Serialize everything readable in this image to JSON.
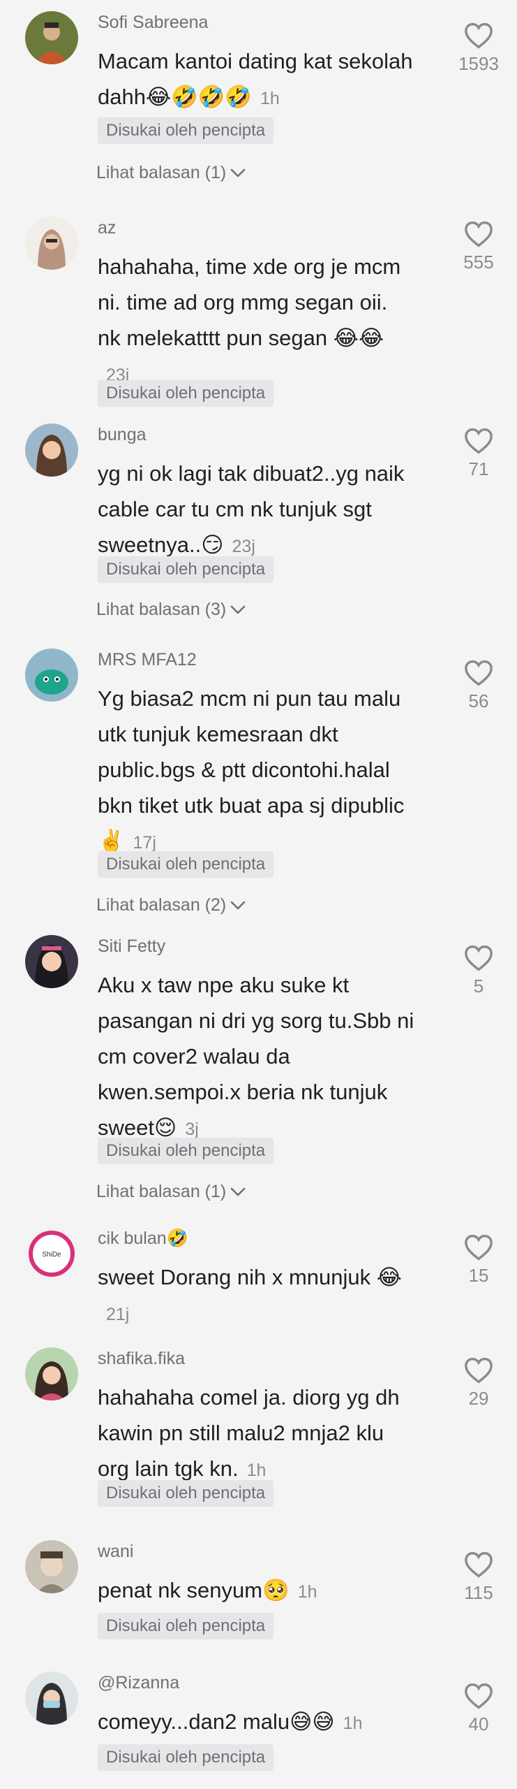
{
  "colors": {
    "background": "#f4f4f4",
    "text": "#1f1f24",
    "muted": "#8a8b91",
    "tag_bg": "#e6e6e8"
  },
  "liked_label": "Disukai oleh pencipta",
  "comments": [
    {
      "user": "Sofi Sabreena",
      "text": "Macam kantoi dating kat sekolah dahh😂🤣🤣🤣",
      "time": "1h",
      "likes": "1593",
      "liked_by_creator": true,
      "replies": "Lihat balasan (1)"
    },
    {
      "user": "az",
      "text": "hahahaha, time xde org je mcm ni. time ad org mmg segan oii. nk melekatttt pun segan 😂😂",
      "time": "23j",
      "likes": "555",
      "liked_by_creator": true,
      "replies": ""
    },
    {
      "user": "bunga",
      "text": "yg ni ok lagi tak dibuat2..yg naik cable car tu cm nk tunjuk sgt sweetnya..😏",
      "time": "23j",
      "likes": "71",
      "liked_by_creator": true,
      "replies": "Lihat balasan (3)"
    },
    {
      "user": "MRS MFA12",
      "text": "Yg biasa2 mcm ni pun tau malu utk tunjuk kemesraan dkt public.bgs & ptt dicontohi.halal bkn tiket utk buat apa sj dipublic ✌️",
      "time": "17j",
      "likes": "56",
      "liked_by_creator": true,
      "replies": "Lihat balasan (2)"
    },
    {
      "user": "Siti Fetty",
      "text": "Aku x taw npe aku suke kt pasangan ni dri yg sorg tu.Sbb ni cm cover2 walau da kwen.sempoi.x beria nk tunjuk sweet😌",
      "time": "3j",
      "likes": "5",
      "liked_by_creator": true,
      "replies": "Lihat balasan (1)"
    },
    {
      "user": "cik bulan🤣",
      "text": "sweet Dorang nih x mnunjuk 😂",
      "time": "21j",
      "likes": "15",
      "liked_by_creator": false,
      "replies": ""
    },
    {
      "user": "shafika.fika",
      "text": "hahahaha comel ja. diorg yg dh kawin pn still malu2 mnja2 klu org lain tgk kn.",
      "time": "1h",
      "likes": "29",
      "liked_by_creator": true,
      "replies": ""
    },
    {
      "user": "wani",
      "text": "penat nk senyum🥺",
      "time": "1h",
      "likes": "115",
      "liked_by_creator": true,
      "replies": ""
    },
    {
      "user": "@Rizanna",
      "text": "comeyy...dan2 malu😅😅",
      "time": "1h",
      "likes": "40",
      "liked_by_creator": true,
      "replies": ""
    }
  ],
  "icons": {
    "like": "heart-outline-icon",
    "expand": "chevron-down-icon"
  },
  "avatar_badge_text": "ShiDe"
}
